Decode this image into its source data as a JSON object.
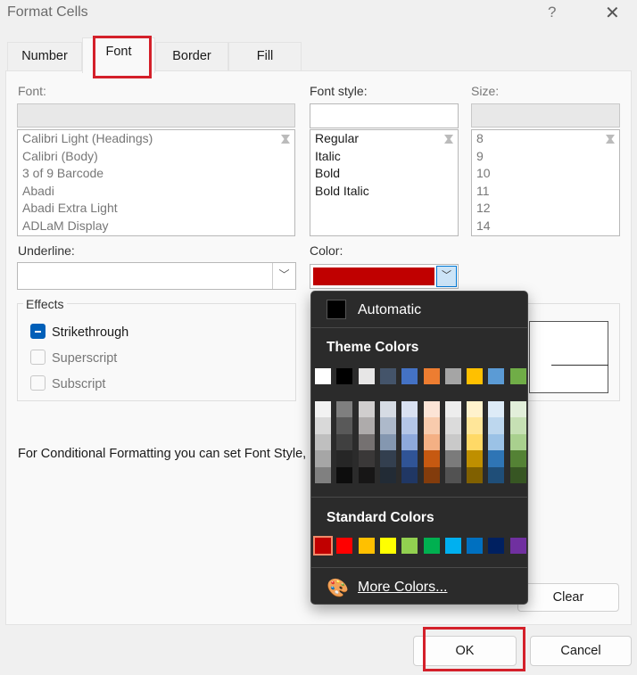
{
  "window": {
    "title": "Format Cells",
    "help": "?",
    "close": "✕"
  },
  "tabs": [
    {
      "label": "Number"
    },
    {
      "label": "Font",
      "active": true
    },
    {
      "label": "Border"
    },
    {
      "label": "Fill"
    }
  ],
  "font": {
    "label": "Font:",
    "value": "",
    "items": [
      "Calibri Light (Headings)",
      "Calibri (Body)",
      "3 of 9 Barcode",
      "Abadi",
      "Abadi Extra Light",
      "ADLaM Display"
    ]
  },
  "font_style": {
    "label": "Font style:",
    "value": "",
    "items": [
      "Regular",
      "Italic",
      "Bold",
      "Bold Italic"
    ]
  },
  "size": {
    "label": "Size:",
    "value": "",
    "items": [
      "8",
      "9",
      "10",
      "11",
      "12",
      "14"
    ]
  },
  "underline": {
    "label": "Underline:",
    "value": ""
  },
  "color": {
    "label": "Color:",
    "selected": "#c00000"
  },
  "effects": {
    "label": "Effects",
    "strikethrough": {
      "label": "Strikethrough",
      "state": "indeterminate"
    },
    "superscript": {
      "label": "Superscript",
      "checked": false
    },
    "subscript": {
      "label": "Subscript",
      "checked": false
    }
  },
  "info_text": "For Conditional Formatting you can set Font Style, U",
  "buttons": {
    "clear": "Clear",
    "ok": "OK",
    "cancel": "Cancel"
  },
  "color_popup": {
    "automatic": "Automatic",
    "theme_header": "Theme Colors",
    "theme": [
      "#ffffff",
      "#000000",
      "#e7e6e6",
      "#44546a",
      "#4472c4",
      "#ed7d31",
      "#a5a5a5",
      "#ffc000",
      "#5b9bd5",
      "#70ad47"
    ],
    "shades": [
      [
        "#f2f2f2",
        "#d9d9d9",
        "#bfbfbf",
        "#a6a6a6",
        "#808080"
      ],
      [
        "#7f7f7f",
        "#595959",
        "#404040",
        "#262626",
        "#0d0d0d"
      ],
      [
        "#d0cece",
        "#aeabab",
        "#757171",
        "#3a3838",
        "#171616"
      ],
      [
        "#d6dce4",
        "#adb9ca",
        "#8497b0",
        "#333f4f",
        "#222b35"
      ],
      [
        "#d9e1f2",
        "#b4c6e7",
        "#8ea9db",
        "#305496",
        "#203764"
      ],
      [
        "#fce4d6",
        "#f8cbad",
        "#f4b084",
        "#c65911",
        "#833c0c"
      ],
      [
        "#ededed",
        "#dbdbdb",
        "#c9c9c9",
        "#7b7b7b",
        "#525252"
      ],
      [
        "#fff2cc",
        "#ffe699",
        "#ffd966",
        "#bf8f00",
        "#806000"
      ],
      [
        "#ddebf7",
        "#bdd7ee",
        "#9bc2e6",
        "#2f75b5",
        "#1f4e78"
      ],
      [
        "#e2efda",
        "#c6e0b4",
        "#a9d08e",
        "#548235",
        "#375623"
      ]
    ],
    "standard_header": "Standard Colors",
    "standard": [
      "#c00000",
      "#ff0000",
      "#ffc000",
      "#ffff00",
      "#92d050",
      "#00b050",
      "#00b0f0",
      "#0070c0",
      "#002060",
      "#7030a0"
    ],
    "more_colors": "More Colors..."
  }
}
